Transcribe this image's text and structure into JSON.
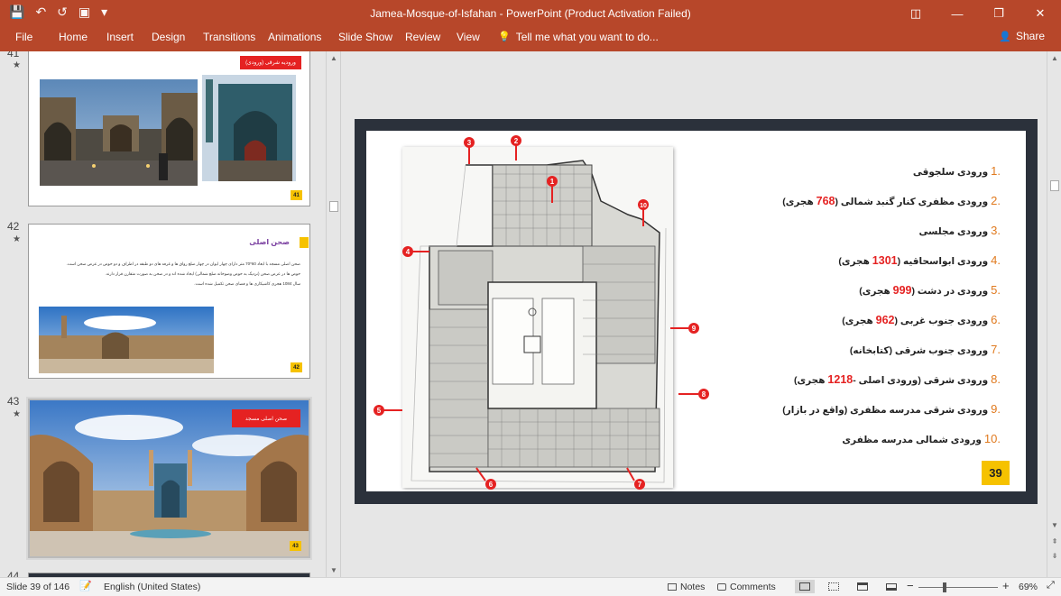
{
  "window": {
    "title": "Jamea-Mosque-of-Isfahan - PowerPoint (Product Activation Failed)",
    "qat": {
      "save_icon": "💾",
      "undo_icon": "↶",
      "redo_icon": "↺",
      "present_icon": "▣",
      "customize_icon": "▾"
    },
    "controls": {
      "restore_ribbon": "◫",
      "minimize": "—",
      "maximize": "❐",
      "close": "✕"
    }
  },
  "ribbon": {
    "tabs": [
      "File",
      "Home",
      "Insert",
      "Design",
      "Transitions",
      "Animations",
      "Slide Show",
      "Review",
      "View"
    ],
    "tell_me": "Tell me what you want to do...",
    "tell_me_icon": "💡",
    "share": "Share",
    "share_icon": "👤"
  },
  "thumbnails": [
    {
      "number": "41",
      "star": "★",
      "header": "ورودیه شرقی (ورودی)",
      "page": "41"
    },
    {
      "number": "42",
      "star": "★",
      "header": "صحن اصلی",
      "line1": "صحن اصلی مسجد با ابعاد 60*70 متر دارای چهار ایوان در چهار ضلع رواق ها و غرفه های دو طبقه در اطراف و دو حوض در عرض صحن است.",
      "line2": "حوض ها در عرض صحن (نزدیک به حوض وضوخانه ضلع شمالی) ایجاد شده اند و در صحن به صورت متقارن قرار دارند.",
      "line3": "سال 1084 هجری کاشیکاری ها و فضای صحن تکمیل شده است.",
      "page": "42"
    },
    {
      "number": "43",
      "star": "★",
      "header": "صحن اصلی مسجد",
      "page": "43"
    },
    {
      "number": "44"
    }
  ],
  "slide": {
    "page_number": "39",
    "items": [
      {
        "num": ".1",
        "text": "ورودی سلجوقی"
      },
      {
        "num": ".2",
        "pre": "ورودی مظفری کنار گنبد شمالی (",
        "hl": "768",
        "post": " هجری)"
      },
      {
        "num": ".3",
        "text": "ورودی مجلسی"
      },
      {
        "num": ".4",
        "pre": "ورودی ابواسحاقیه (",
        "hl": "1301",
        "post": " هجری)"
      },
      {
        "num": ".5",
        "pre": "ورودی در دشت (",
        "hl": "999",
        "post": " هجری)"
      },
      {
        "num": ".6",
        "pre": "ورودی جنوب غربی (",
        "hl": "962",
        "post": " هجری)"
      },
      {
        "num": ".7",
        "text": "ورودی جنوب شرقی (کتابخانه)"
      },
      {
        "num": ".8",
        "pre": "ورودی شرقی (ورودی اصلی -",
        "hl": "1218",
        "post": " هجری)"
      },
      {
        "num": ".9",
        "text": "ورودی شرقی مدرسه مظفری (واقع در بازار)"
      },
      {
        "num": ".10",
        "text": "ورودی شمالی مدرسه مظفری"
      }
    ],
    "markers": [
      "1",
      "2",
      "3",
      "4",
      "5",
      "6",
      "7",
      "8",
      "9",
      "10"
    ]
  },
  "scrollbars": {
    "up": "▲",
    "down": "▼",
    "prev_slide": "⇞",
    "next_slide": "⇟"
  },
  "status": {
    "slide_info": "Slide 39 of 146",
    "notes_icon": "📝",
    "language": "English (United States)",
    "notes": "Notes",
    "comments": "Comments",
    "zoom_minus": "−",
    "zoom_plus": "+",
    "zoom_level": "69%",
    "zoom_fraction": 0.69
  },
  "colors": {
    "accent": "#b7472a",
    "highlight_red": "#e52222",
    "number_orange": "#e07a1f",
    "badge_yellow": "#f6c200",
    "frame_dark": "#2b313b"
  }
}
